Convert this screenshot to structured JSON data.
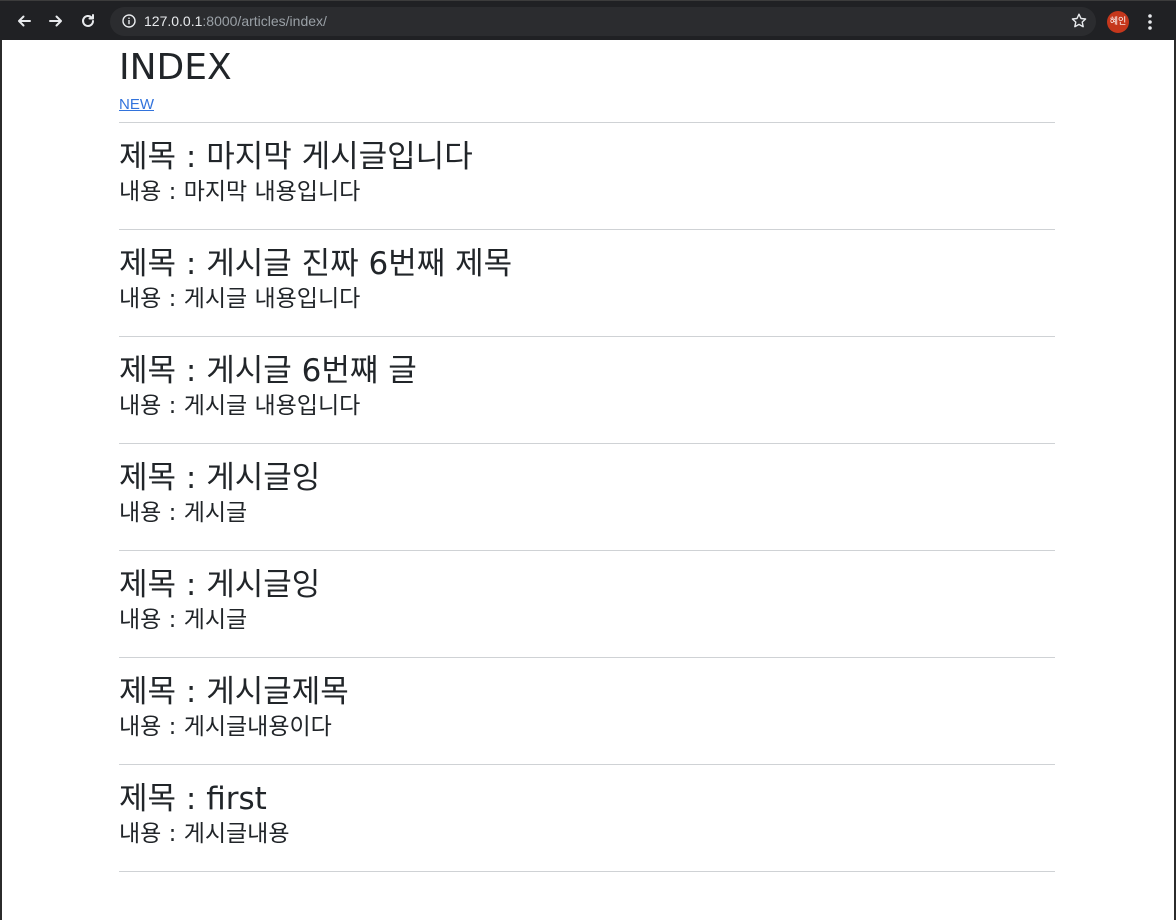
{
  "browser": {
    "url_host": "127.0.0.1",
    "url_path": ":8000/articles/index/",
    "profile_initials": "혜인"
  },
  "page": {
    "title": "INDEX",
    "new_link": "NEW"
  },
  "articles": [
    {
      "title": "제목 : 마지막 게시글입니다",
      "content": "내용 : 마지막 내용입니다"
    },
    {
      "title": "제목 : 게시글 진짜 6번째 제목",
      "content": "내용 : 게시글 내용입니다"
    },
    {
      "title": "제목 : 게시글 6번쨰 글",
      "content": "내용 : 게시글 내용입니다"
    },
    {
      "title": "제목 : 게시글잉",
      "content": "내용 : 게시글"
    },
    {
      "title": "제목 : 게시글잉",
      "content": "내용 : 게시글"
    },
    {
      "title": "제목 : 게시글제목",
      "content": "내용 : 게시글내용이다"
    },
    {
      "title": "제목 : first",
      "content": "내용 : 게시글내용"
    }
  ],
  "colors": {
    "toolbar_bg": "#202124",
    "link": "#3273dc",
    "text": "#212529",
    "divider": "#cfd2d5",
    "avatar": "#c5371c"
  }
}
